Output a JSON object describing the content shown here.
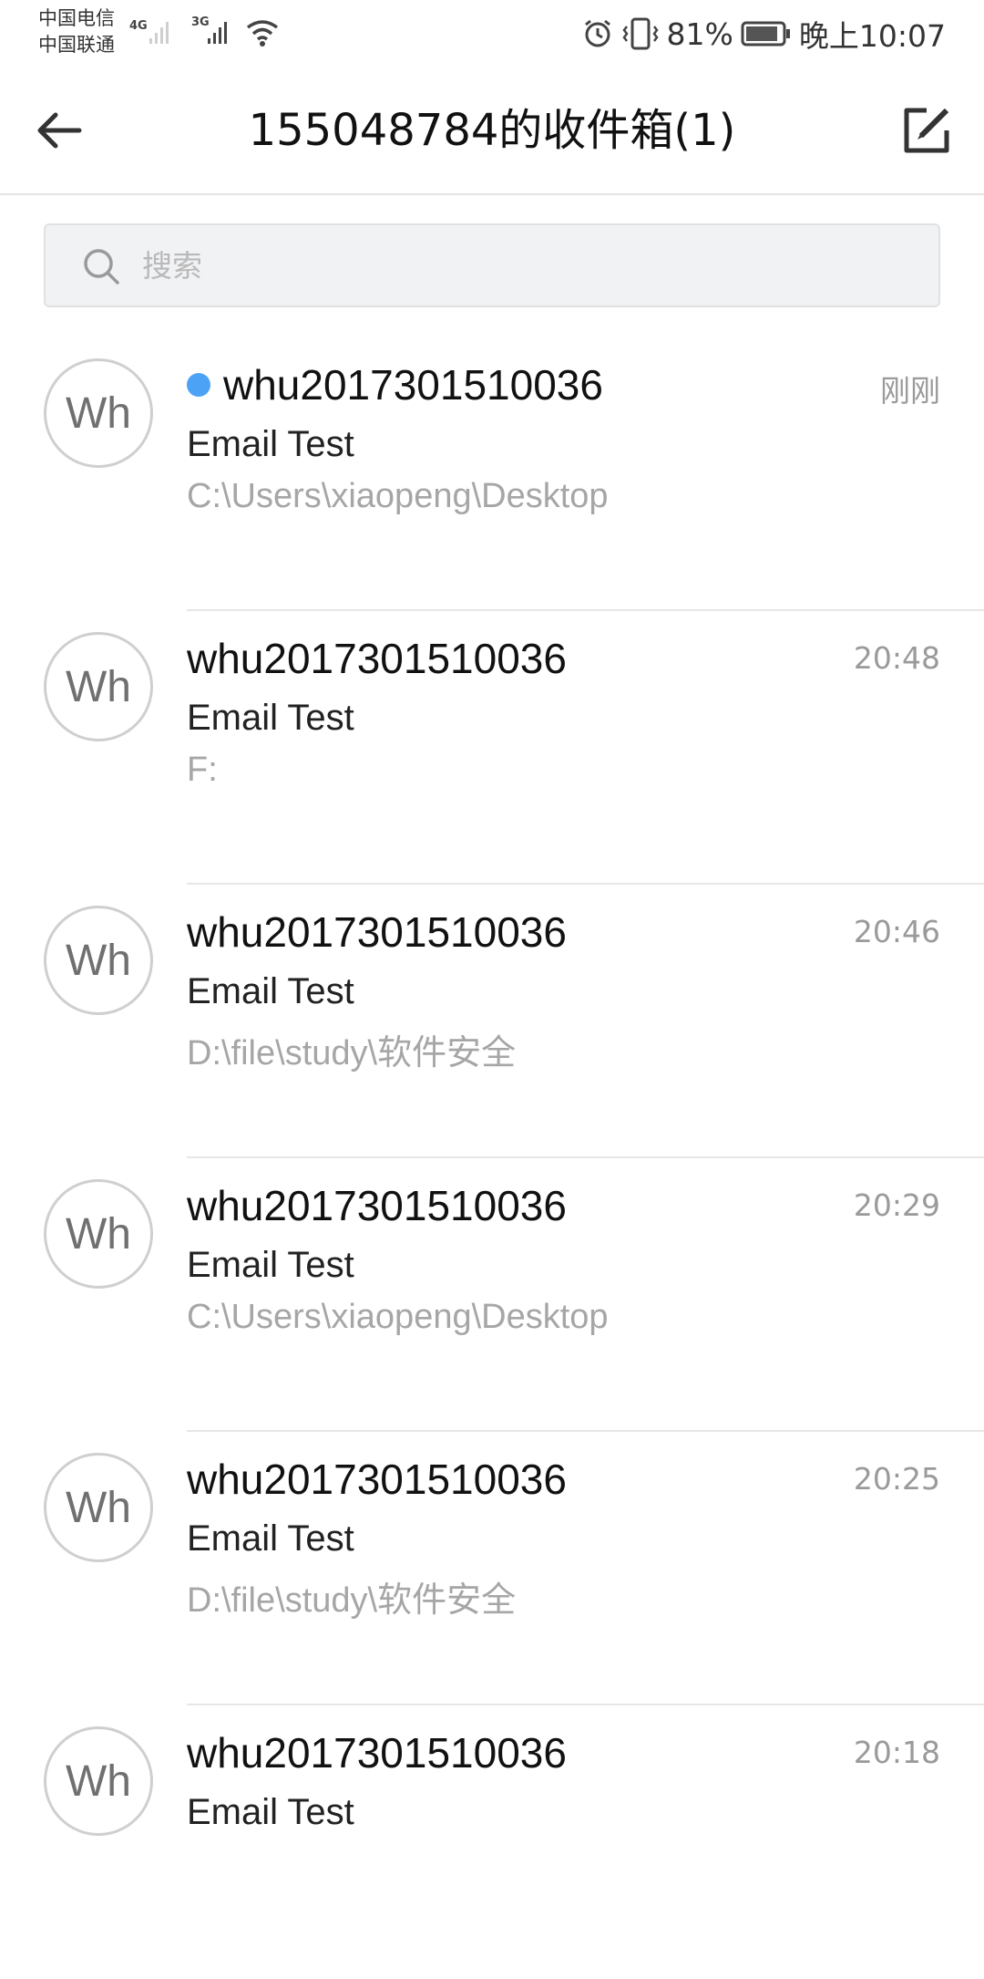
{
  "status_bar": {
    "carrier_1": "中国电信",
    "carrier_2": "中国联通",
    "net_1": "4G",
    "net_2": "3G",
    "battery_percent": "81%",
    "time": "晚上10:07",
    "icons": [
      "signal-icon",
      "wifi-icon",
      "alarm-icon",
      "vibrate-icon",
      "battery-icon"
    ]
  },
  "header": {
    "title": "155048784的收件箱(1)",
    "back_icon": "back-arrow-icon",
    "compose_icon": "compose-icon"
  },
  "search": {
    "placeholder": "搜索",
    "value": ""
  },
  "mails": [
    {
      "avatar": "Wh",
      "sender": "whu2017301510036",
      "time": "刚刚",
      "subject": "Email Test",
      "preview": "C:\\Users\\xiaopeng\\Desktop",
      "unread": true
    },
    {
      "avatar": "Wh",
      "sender": "whu2017301510036",
      "time": "20:48",
      "subject": "Email Test",
      "preview": "F:",
      "unread": false
    },
    {
      "avatar": "Wh",
      "sender": "whu2017301510036",
      "time": "20:46",
      "subject": "Email Test",
      "preview": "D:\\file\\study\\软件安全",
      "unread": false
    },
    {
      "avatar": "Wh",
      "sender": "whu2017301510036",
      "time": "20:29",
      "subject": "Email Test",
      "preview": "C:\\Users\\xiaopeng\\Desktop",
      "unread": false
    },
    {
      "avatar": "Wh",
      "sender": "whu2017301510036",
      "time": "20:25",
      "subject": "Email Test",
      "preview": "D:\\file\\study\\软件安全",
      "unread": false
    },
    {
      "avatar": "Wh",
      "sender": "whu2017301510036",
      "time": "20:18",
      "subject": "Email Test",
      "preview": "",
      "unread": false
    }
  ],
  "colors": {
    "unread_dot": "#4ca3f5",
    "time_text": "#9a9a9a",
    "preview_text": "#a6a6a6"
  }
}
